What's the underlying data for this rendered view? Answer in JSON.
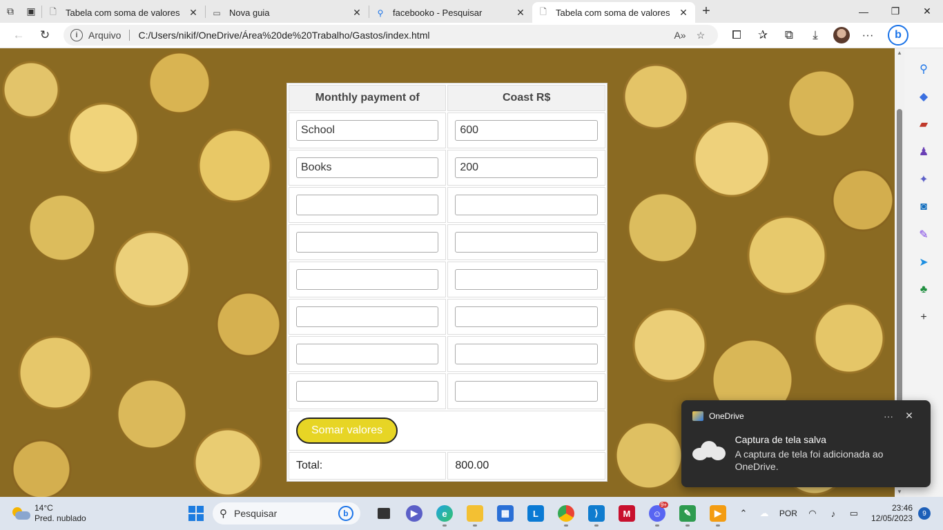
{
  "browser": {
    "tabs": [
      {
        "label": "Tabela com soma de valores",
        "icon": "page-icon",
        "active": false
      },
      {
        "label": "Nova guia",
        "icon": "newtab-icon",
        "active": false
      },
      {
        "label": "facebooko - Pesquisar",
        "icon": "search-icon",
        "active": false
      },
      {
        "label": "Tabela com soma de valores",
        "icon": "page-icon",
        "active": true
      }
    ],
    "address": {
      "scheme_label": "Arquivo",
      "url": "C:/Users/nikif/OneDrive/Área%20de%20Trabalho/Gastos/index.html"
    }
  },
  "page": {
    "table": {
      "header_item": "Monthly payment of",
      "header_cost": "Coast R$",
      "rows": [
        {
          "item": "School",
          "cost": "600"
        },
        {
          "item": "Books",
          "cost": "200"
        },
        {
          "item": "",
          "cost": ""
        },
        {
          "item": "",
          "cost": ""
        },
        {
          "item": "",
          "cost": ""
        },
        {
          "item": "",
          "cost": ""
        },
        {
          "item": "",
          "cost": ""
        },
        {
          "item": "",
          "cost": ""
        }
      ],
      "button_label": "Somar valores",
      "total_label": "Total:",
      "total_value": "800.00"
    }
  },
  "notification": {
    "app": "OneDrive",
    "title": "Captura de tela salva",
    "message": "A captura de tela foi adicionada ao OneDrive."
  },
  "taskbar": {
    "weather_temp": "14°C",
    "weather_desc": "Pred. nublado",
    "search_label": "Pesquisar",
    "language": "POR",
    "time": "23:46",
    "date": "12/05/2023",
    "notification_count": "9",
    "discord_badge": "9+"
  },
  "colors": {
    "button_bg": "#e7d525",
    "accent": "#1d7ce0"
  }
}
